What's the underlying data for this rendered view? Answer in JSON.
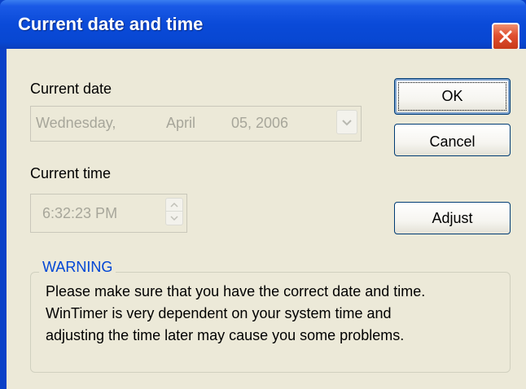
{
  "window": {
    "title": "Current date and time",
    "close_icon": "close-icon"
  },
  "date": {
    "label": "Current date",
    "weekday": "Wednesday,",
    "month": "April",
    "day_year": "05, 2006",
    "dropdown_icon": "chevron-down-icon"
  },
  "time": {
    "label": "Current time",
    "value": "6:32:23 PM",
    "spinner_icon": "spinner-icon"
  },
  "buttons": {
    "ok": "OK",
    "cancel": "Cancel",
    "adjust": "Adjust"
  },
  "warning": {
    "title": "WARNING",
    "lines": [
      "Please make sure that you have the correct date and time.",
      "WinTimer is very dependent on your system time and",
      "adjusting the time later may cause you some problems."
    ]
  },
  "colors": {
    "titlebar": "#0a4ad8",
    "dialog_bg": "#ece9d8",
    "warning_title": "#0046d5",
    "disabled_text": "#a7a69a"
  }
}
